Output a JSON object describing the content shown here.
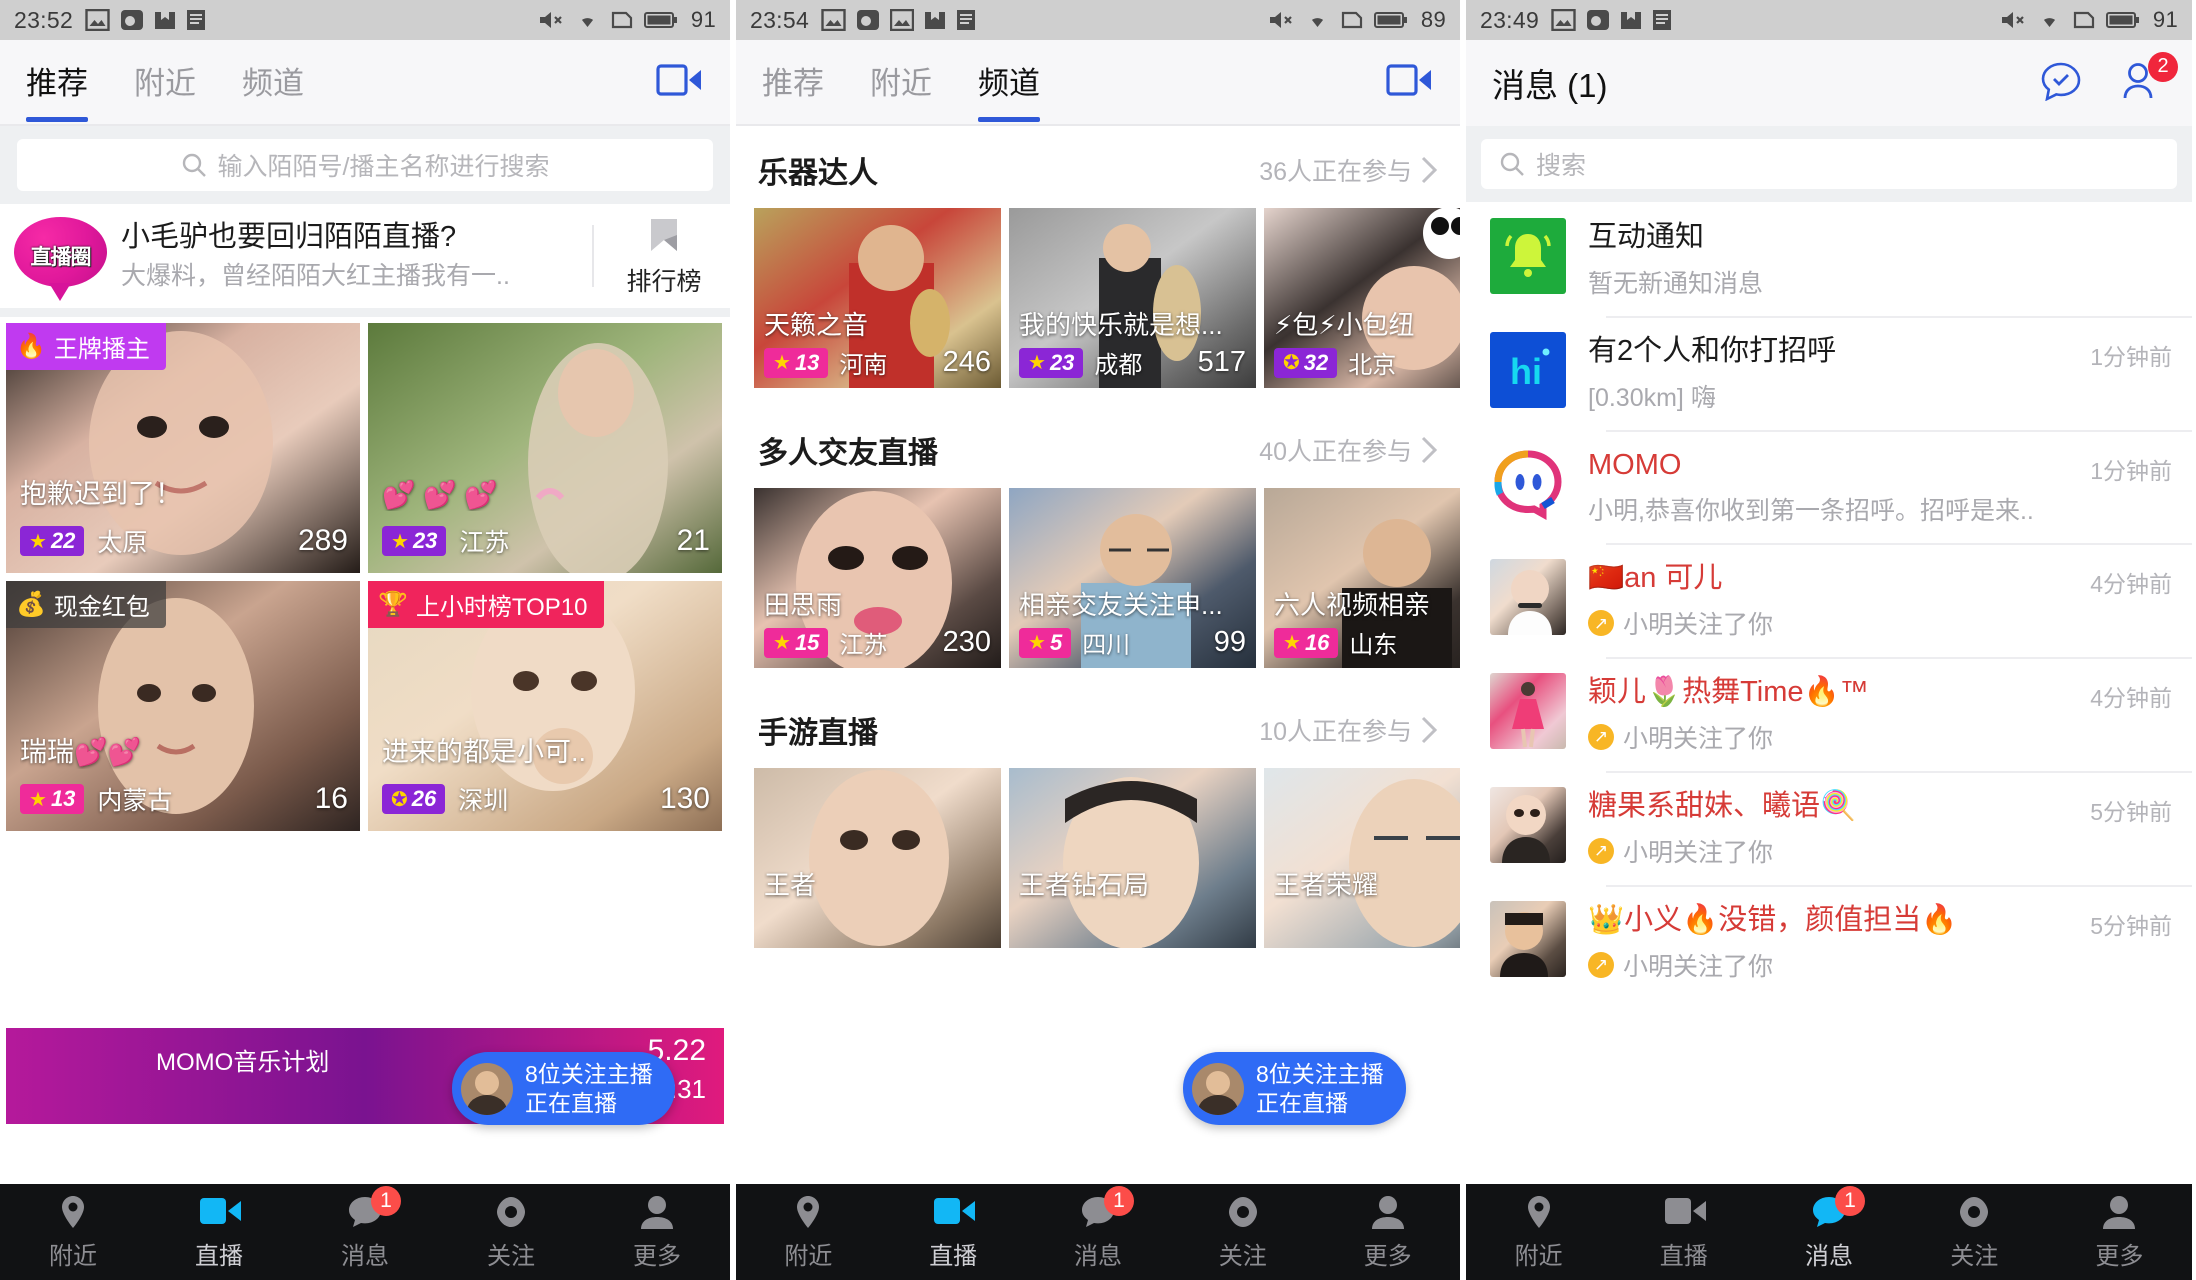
{
  "panel1": {
    "status_bar": {
      "time": "23:52",
      "battery": "91",
      "icons": [
        "image-icon",
        "weibo-icon",
        "archive-icon",
        "document-icon"
      ],
      "right_icons": [
        "volume-mute-icon",
        "wifi-icon",
        "sim-icon",
        "battery-icon"
      ]
    },
    "tabs": [
      {
        "label": "推荐",
        "active": true
      },
      {
        "label": "附近",
        "active": false
      },
      {
        "label": "频道",
        "active": false
      }
    ],
    "camera_icon": "video-camera-icon",
    "search": {
      "placeholder": "输入陌陌号/播主名称进行搜索",
      "icon": "search-icon"
    },
    "promo": {
      "logo_text": "直播圈",
      "title": "小毛驴也要回归陌陌直播?",
      "subtitle": "大爆料，曾经陌陌大红主播我有一..",
      "rank_label": "排行榜",
      "rank_icon": "bookmark-icon"
    },
    "cards": [
      {
        "badge": "王牌播主",
        "badge_emoji": "🔥",
        "badge_style": "purple",
        "title": "抱歉迟到了！",
        "level": "22",
        "level_style": "purple",
        "city": "太原",
        "count": "289"
      },
      {
        "badge": "",
        "badge_emoji": "",
        "badge_style": "",
        "title": "💕 💕 💕",
        "level": "23",
        "level_style": "purple",
        "city": "江苏",
        "count": "21"
      },
      {
        "badge": "现金红包",
        "badge_emoji": "💰",
        "badge_style": "grey",
        "title": "瑞瑞💕💕",
        "level": "13",
        "level_style": "pink",
        "city": "内蒙古",
        "count": "16"
      },
      {
        "badge": "上小时榜TOP10",
        "badge_emoji": "🏆",
        "badge_style": "red",
        "title": "进来的都是小可..",
        "level": "26",
        "level_style": "purple",
        "city": "深圳",
        "count": "130"
      }
    ],
    "follow_pill": {
      "line1": "8位关注主播",
      "line2": "正在直播"
    },
    "music_banner": {
      "text": "MOMO音乐计划",
      "time": "5.22",
      "date": "23:31"
    },
    "bottom_nav": [
      {
        "label": "附近",
        "icon": "location-pin-icon",
        "active": false,
        "badge": ""
      },
      {
        "label": "直播",
        "icon": "video-camera-icon",
        "active": true,
        "badge": ""
      },
      {
        "label": "消息",
        "icon": "chat-bubble-icon",
        "active": false,
        "badge": "1"
      },
      {
        "label": "关注",
        "icon": "eye-icon",
        "active": false,
        "badge": ""
      },
      {
        "label": "更多",
        "icon": "person-icon",
        "active": false,
        "badge": ""
      }
    ]
  },
  "panel2": {
    "status_bar": {
      "time": "23:54",
      "battery": "89",
      "icons": [
        "image-icon",
        "weibo-icon",
        "photo-icon",
        "archive-icon",
        "document-icon"
      ]
    },
    "tabs": [
      {
        "label": "推荐",
        "active": false
      },
      {
        "label": "附近",
        "active": false
      },
      {
        "label": "频道",
        "active": true
      }
    ],
    "camera_icon": "video-camera-icon",
    "sections": [
      {
        "title": "乐器达人",
        "meta": "36人正在参与",
        "chevron": "chevron-right-icon",
        "cards": [
          {
            "title": "天籁之音",
            "level": "13",
            "level_style": "pink",
            "city": "河南",
            "count": "246"
          },
          {
            "title": "我的快乐就是想...",
            "level": "23",
            "level_style": "purple",
            "city": "成都",
            "count": "517"
          },
          {
            "title": "⚡包⚡小包纽",
            "level": "32",
            "level_style": "purple",
            "city": "北京",
            "count": ""
          }
        ]
      },
      {
        "title": "多人交友直播",
        "meta": "40人正在参与",
        "chevron": "chevron-right-icon",
        "cards": [
          {
            "title": "田思雨",
            "level": "15",
            "level_style": "pink",
            "city": "江苏",
            "count": "230"
          },
          {
            "title": "相亲交友关注申...",
            "level": "5",
            "level_style": "pink",
            "city": "四川",
            "count": "99"
          },
          {
            "title": "六人视频相亲",
            "level": "16",
            "level_style": "pink",
            "city": "山东",
            "count": ""
          }
        ]
      },
      {
        "title": "手游直播",
        "meta": "10人正在参与",
        "chevron": "chevron-right-icon",
        "cards": [
          {
            "title": "王者",
            "level": "",
            "level_style": "pink",
            "city": "",
            "count": ""
          },
          {
            "title": "王者钻石局",
            "level": "",
            "level_style": "pink",
            "city": "",
            "count": ""
          },
          {
            "title": "王者荣耀",
            "level": "",
            "level_style": "pink",
            "city": "",
            "count": ""
          }
        ]
      }
    ],
    "follow_pill": {
      "line1": "8位关注主播",
      "line2": "正在直播"
    },
    "bottom_nav": [
      {
        "label": "附近",
        "icon": "location-pin-icon",
        "active": false,
        "badge": ""
      },
      {
        "label": "直播",
        "icon": "video-camera-icon",
        "active": true,
        "badge": ""
      },
      {
        "label": "消息",
        "icon": "chat-bubble-icon",
        "active": false,
        "badge": "1"
      },
      {
        "label": "关注",
        "icon": "eye-icon",
        "active": false,
        "badge": ""
      },
      {
        "label": "更多",
        "icon": "person-icon",
        "active": false,
        "badge": ""
      }
    ]
  },
  "panel3": {
    "status_bar": {
      "time": "23:49",
      "battery": "91",
      "icons": [
        "image-icon",
        "weibo-icon",
        "archive-icon",
        "document-icon"
      ]
    },
    "header": {
      "title": "消息 (1)",
      "action1_icon": "chat-check-icon",
      "action2_icon": "contacts-icon",
      "action2_badge": "2"
    },
    "search": {
      "placeholder": "搜索",
      "icon": "search-icon"
    },
    "messages": [
      {
        "name": "互动通知",
        "name_accent": false,
        "sub": "暂无新通知消息",
        "time": "",
        "avatar": "bell-icon",
        "avatar_style": "green",
        "follow_icon": false
      },
      {
        "name": "有2个人和你打招呼",
        "name_accent": false,
        "sub": "[0.30km] 嗨",
        "time": "1分钟前",
        "avatar": "hi-icon",
        "avatar_style": "blue",
        "follow_icon": false
      },
      {
        "name": "MOMO",
        "name_accent": true,
        "sub": "小明,恭喜你收到第一条招呼。招呼是来..",
        "time": "1分钟前",
        "avatar": "momo-logo-icon",
        "avatar_style": "momo",
        "follow_icon": false
      },
      {
        "name": "🇨🇳an 可儿",
        "name_accent": true,
        "sub": "小明关注了你",
        "time": "4分钟前",
        "avatar": "user-photo",
        "avatar_style": "photo1",
        "follow_icon": true
      },
      {
        "name": "颖儿🌷热舞Time🔥™",
        "name_accent": true,
        "sub": "小明关注了你",
        "time": "4分钟前",
        "avatar": "user-photo",
        "avatar_style": "photo2",
        "follow_icon": true
      },
      {
        "name": "糖果系甜妹、曦语🍭",
        "name_accent": true,
        "sub": "小明关注了你",
        "time": "5分钟前",
        "avatar": "user-photo",
        "avatar_style": "photo3",
        "follow_icon": true
      },
      {
        "name": "👑小义🔥没错，颜值担当🔥",
        "name_accent": true,
        "sub": "小明关注了你",
        "time": "5分钟前",
        "avatar": "user-photo",
        "avatar_style": "photo4",
        "follow_icon": true
      }
    ],
    "bottom_nav": [
      {
        "label": "附近",
        "icon": "location-pin-icon",
        "active": false,
        "badge": ""
      },
      {
        "label": "直播",
        "icon": "video-camera-icon",
        "active": false,
        "badge": ""
      },
      {
        "label": "消息",
        "icon": "chat-bubble-icon",
        "active": true,
        "badge": "1"
      },
      {
        "label": "关注",
        "icon": "eye-icon",
        "active": false,
        "badge": ""
      },
      {
        "label": "更多",
        "icon": "person-icon",
        "active": false,
        "badge": ""
      }
    ]
  },
  "colors": {
    "accent_blue": "#2f58d8",
    "nav_active": "#12b7f5",
    "badge_red": "#fc4d49",
    "promo_pink": "#e0189b"
  }
}
